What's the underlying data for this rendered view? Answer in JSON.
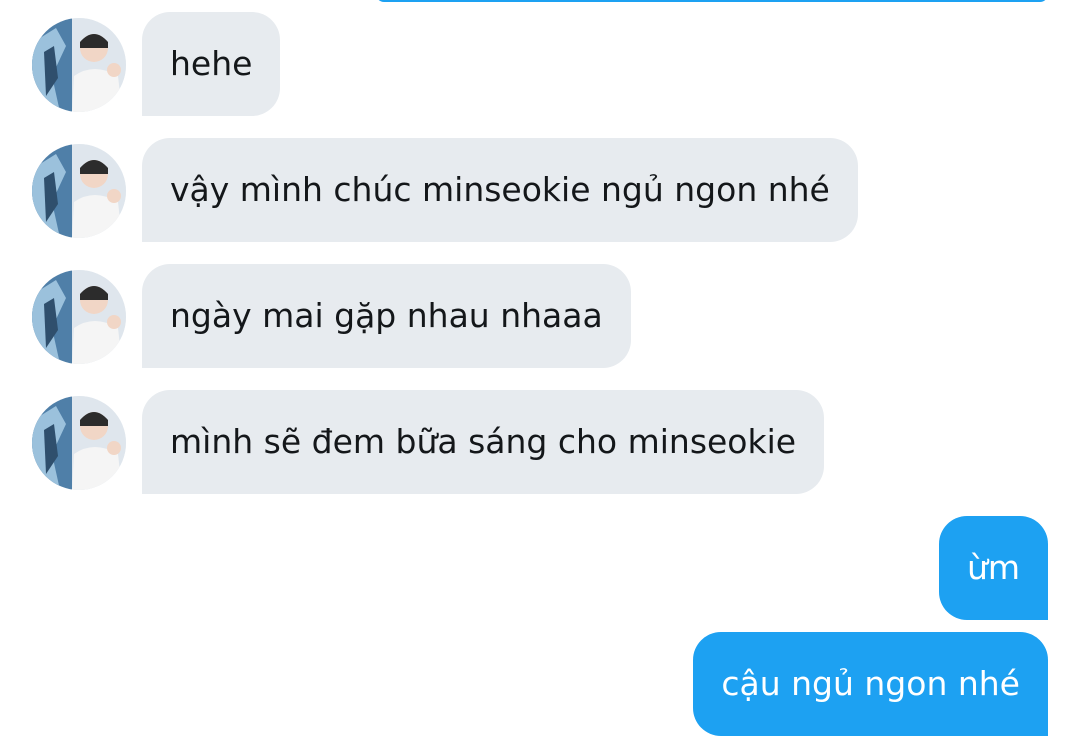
{
  "colors": {
    "incoming_bubble": "#e7ebef",
    "outgoing_bubble": "#1da1f2",
    "incoming_text": "#14171a",
    "outgoing_text": "#ffffff"
  },
  "conversation": {
    "messages": [
      {
        "direction": "incoming",
        "text": "hehe",
        "avatar_icon": "user-avatar-photo"
      },
      {
        "direction": "incoming",
        "text": "vậy mình chúc minseokie ngủ ngon nhé",
        "avatar_icon": "user-avatar-photo"
      },
      {
        "direction": "incoming",
        "text": "ngày mai gặp nhau nhaaa",
        "avatar_icon": "user-avatar-photo"
      },
      {
        "direction": "incoming",
        "text": "mình sẽ đem bữa sáng cho minseokie",
        "avatar_icon": "user-avatar-photo"
      },
      {
        "direction": "outgoing",
        "text": "ừm"
      },
      {
        "direction": "outgoing",
        "text": "cậu ngủ ngon nhé"
      }
    ]
  }
}
